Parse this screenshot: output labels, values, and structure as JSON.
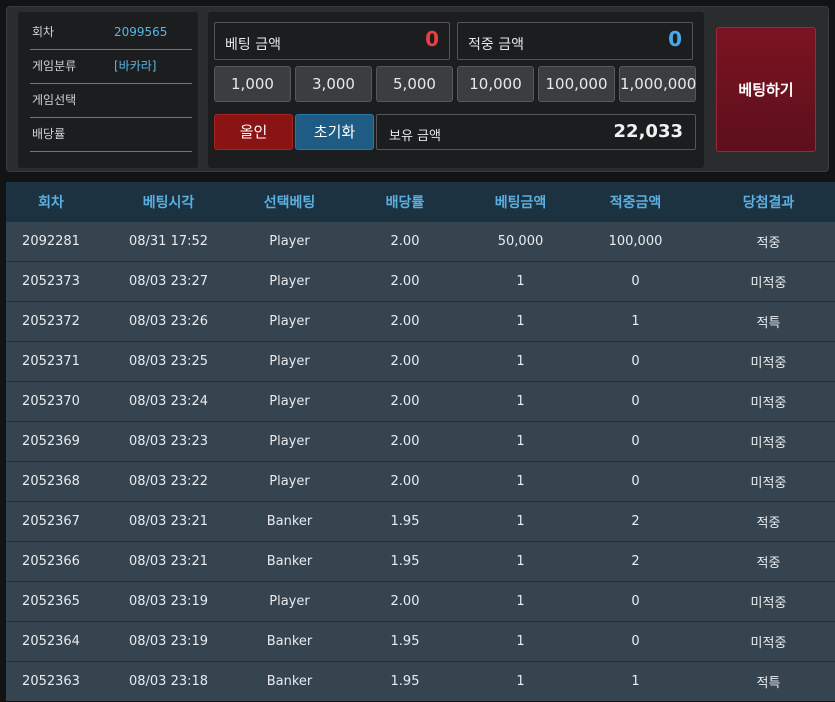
{
  "info": {
    "round_label": "회차",
    "round_value": "2099565",
    "category_label": "게임분류",
    "category_value": "[바카라]",
    "selection_label": "게임선택",
    "selection_value": "",
    "odds_label": "배당률",
    "odds_value": ""
  },
  "bet": {
    "bet_amount_label": "베팅 금액",
    "bet_amount_value": "0",
    "win_amount_label": "적중 금액",
    "win_amount_value": "0",
    "chips": [
      "1,000",
      "3,000",
      "5,000",
      "10,000",
      "100,000",
      "1,000,000"
    ],
    "allin_label": "올인",
    "reset_label": "초기화",
    "balance_label": "보유 금액",
    "balance_value": "22,033",
    "submit_label": "베팅하기"
  },
  "colors": {
    "bet_value": "#e84040",
    "win_value": "#4aa8e8"
  },
  "history": {
    "headers": [
      "회차",
      "베팅시각",
      "선택베팅",
      "배당률",
      "베팅금액",
      "적중금액",
      "당첨결과"
    ],
    "rows": [
      [
        "2092281",
        "08/31 17:52",
        "Player",
        "2.00",
        "50,000",
        "100,000",
        "적중"
      ],
      [
        "2052373",
        "08/03 23:27",
        "Player",
        "2.00",
        "1",
        "0",
        "미적중"
      ],
      [
        "2052372",
        "08/03 23:26",
        "Player",
        "2.00",
        "1",
        "1",
        "적특"
      ],
      [
        "2052371",
        "08/03 23:25",
        "Player",
        "2.00",
        "1",
        "0",
        "미적중"
      ],
      [
        "2052370",
        "08/03 23:24",
        "Player",
        "2.00",
        "1",
        "0",
        "미적중"
      ],
      [
        "2052369",
        "08/03 23:23",
        "Player",
        "2.00",
        "1",
        "0",
        "미적중"
      ],
      [
        "2052368",
        "08/03 23:22",
        "Player",
        "2.00",
        "1",
        "0",
        "미적중"
      ],
      [
        "2052367",
        "08/03 23:21",
        "Banker",
        "1.95",
        "1",
        "2",
        "적중"
      ],
      [
        "2052366",
        "08/03 23:21",
        "Banker",
        "1.95",
        "1",
        "2",
        "적중"
      ],
      [
        "2052365",
        "08/03 23:19",
        "Player",
        "2.00",
        "1",
        "0",
        "미적중"
      ],
      [
        "2052364",
        "08/03 23:19",
        "Banker",
        "1.95",
        "1",
        "0",
        "미적중"
      ],
      [
        "2052363",
        "08/03 23:18",
        "Banker",
        "1.95",
        "1",
        "1",
        "적특"
      ]
    ]
  }
}
